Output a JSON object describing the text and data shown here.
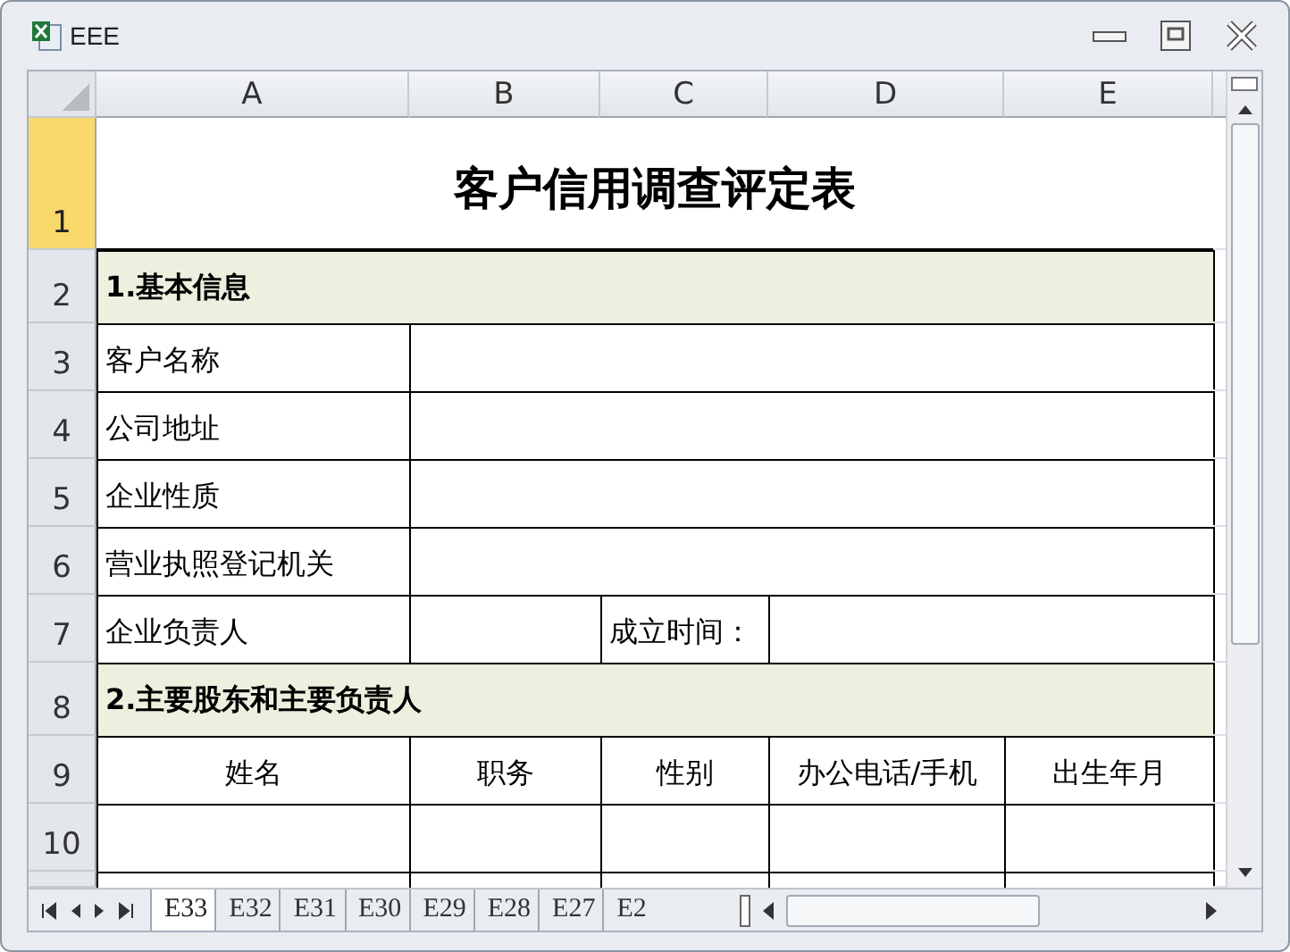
{
  "window": {
    "title": "EEE"
  },
  "columns": [
    "A",
    "B",
    "C",
    "D",
    "E"
  ],
  "rows": [
    {
      "header": "1",
      "selected": true,
      "kind": "full",
      "cells": [
        {
          "kind": "title",
          "text": "客户信用调查评定表"
        }
      ]
    },
    {
      "header": "2",
      "selected": false,
      "kind": "full",
      "cells": [
        {
          "kind": "section",
          "text": "1.基本信息"
        }
      ]
    },
    {
      "header": "3",
      "selected": false,
      "kind": "label_value",
      "cells": [
        {
          "kind": "label",
          "text": "客户名称"
        },
        {
          "kind": "blank"
        }
      ]
    },
    {
      "header": "4",
      "selected": false,
      "kind": "label_value",
      "cells": [
        {
          "kind": "label",
          "text": "公司地址"
        },
        {
          "kind": "blank"
        }
      ]
    },
    {
      "header": "5",
      "selected": false,
      "kind": "label_value",
      "cells": [
        {
          "kind": "label",
          "text": "企业性质"
        },
        {
          "kind": "blank"
        }
      ]
    },
    {
      "header": "6",
      "selected": false,
      "kind": "label_value",
      "cells": [
        {
          "kind": "label",
          "text": "营业执照登记机关"
        },
        {
          "kind": "blank"
        }
      ]
    },
    {
      "header": "7",
      "selected": false,
      "kind": "two_pairs",
      "cells": [
        {
          "kind": "label",
          "text": "企业负责人"
        },
        {
          "kind": "blank"
        },
        {
          "kind": "label",
          "text": "成立时间："
        },
        {
          "kind": "blank"
        }
      ]
    },
    {
      "header": "8",
      "selected": false,
      "kind": "full",
      "cells": [
        {
          "kind": "section",
          "text": "2.主要股东和主要负责人"
        }
      ]
    },
    {
      "header": "9",
      "selected": false,
      "kind": "columns",
      "cells": [
        {
          "kind": "header",
          "text": "姓名"
        },
        {
          "kind": "header",
          "text": "职务"
        },
        {
          "kind": "header",
          "text": "性别"
        },
        {
          "kind": "header",
          "text": "办公电话/手机"
        },
        {
          "kind": "header",
          "text": "出生年月"
        }
      ]
    },
    {
      "header": "10",
      "selected": false,
      "kind": "columns",
      "cells": [
        {
          "kind": "blank"
        },
        {
          "kind": "blank"
        },
        {
          "kind": "blank"
        },
        {
          "kind": "blank"
        },
        {
          "kind": "blank"
        }
      ]
    }
  ],
  "sheet_tabs": [
    {
      "label": "E33",
      "selected": true
    },
    {
      "label": "E32",
      "selected": false
    },
    {
      "label": "E31",
      "selected": false
    },
    {
      "label": "E30",
      "selected": false
    },
    {
      "label": "E29",
      "selected": false
    },
    {
      "label": "E28",
      "selected": false
    },
    {
      "label": "E27",
      "selected": false
    },
    {
      "label": "E2",
      "selected": false
    }
  ]
}
